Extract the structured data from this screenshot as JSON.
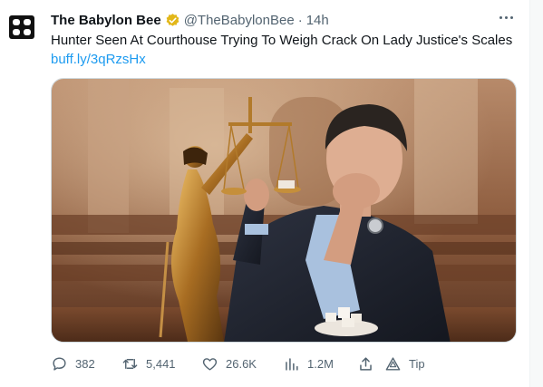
{
  "tweet": {
    "author_name": "The Babylon Bee",
    "handle": "@TheBabylonBee",
    "separator": "·",
    "time": "14h",
    "text": "Hunter Seen At Courthouse Trying To Weigh Crack On Lady Justice's Scales",
    "link": "buff.ly/3qRzsHx"
  },
  "actions": {
    "replies": "382",
    "retweets": "5,441",
    "likes": "26.6K",
    "views": "1.2M",
    "tip_label": "Tip"
  },
  "icons": {
    "avatar": "babylon-bee-logo-icon",
    "verified": "gold-verified-badge-icon",
    "more": "more-options-icon",
    "reply": "reply-icon",
    "retweet": "retweet-icon",
    "like": "heart-icon",
    "views": "analytics-icon",
    "share": "share-icon",
    "tip": "tip-icon"
  },
  "colors": {
    "link": "#1d9bf0",
    "verified_badge": "#e2b719",
    "muted_text": "#536471",
    "primary_text": "#0f1419"
  }
}
